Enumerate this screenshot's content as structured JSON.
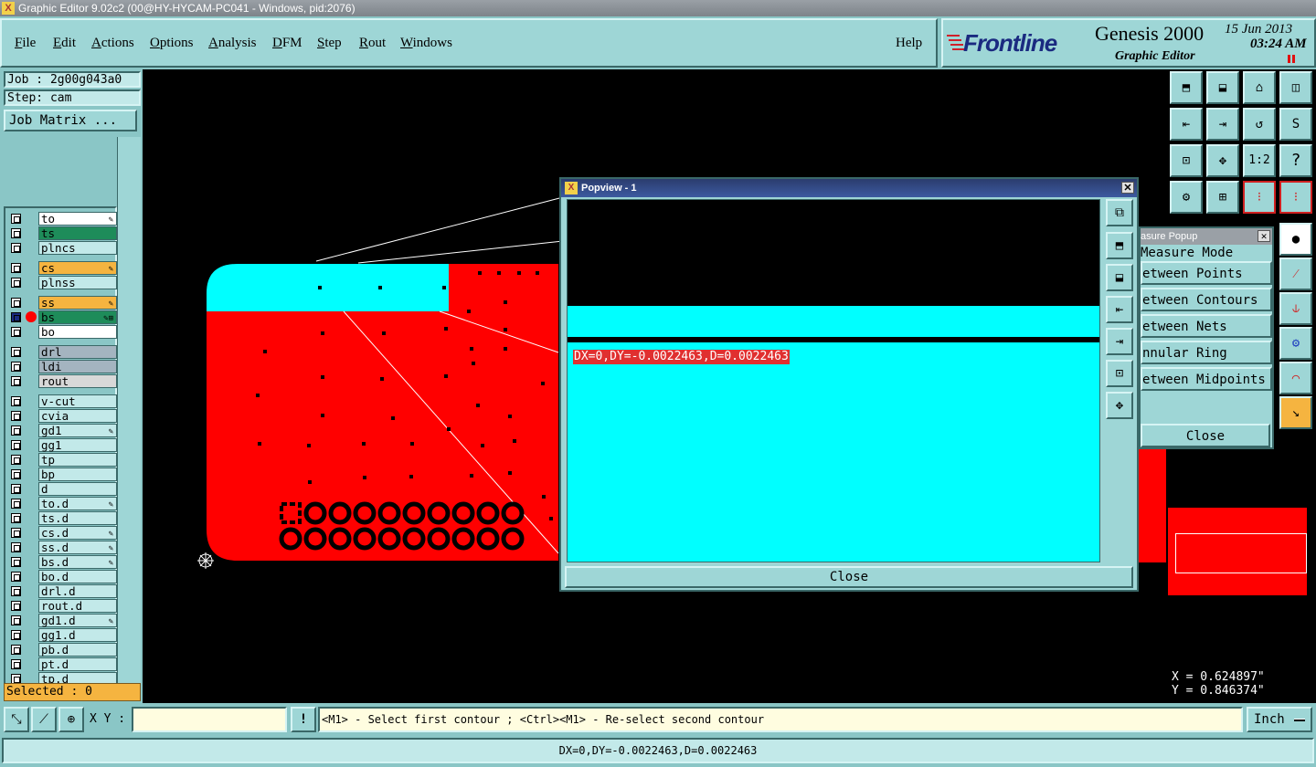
{
  "window": {
    "title": "Graphic Editor 9.02c2 (00@HY-HYCAM-PC041 - Windows, pid:2076)"
  },
  "menu": {
    "items": [
      {
        "label": "File",
        "underline": "F",
        "rest": "ile"
      },
      {
        "label": "Edit",
        "underline": "E",
        "rest": "dit"
      },
      {
        "label": "Actions",
        "underline": "A",
        "rest": "ctions"
      },
      {
        "label": "Options",
        "underline": "O",
        "rest": "ptions"
      },
      {
        "label": "Analysis",
        "underline": "A",
        "rest": "nalysis"
      },
      {
        "label": "DFM",
        "underline": "D",
        "rest": "FM"
      },
      {
        "label": "Step",
        "underline": "S",
        "rest": "tep"
      },
      {
        "label": "Rout",
        "underline": "R",
        "rest": "out"
      },
      {
        "label": "Windows",
        "underline": "W",
        "rest": "indows"
      }
    ],
    "help": "Help"
  },
  "brand": {
    "logo": "Frontline",
    "product": "Genesis 2000",
    "subtitle": "Graphic Editor",
    "date": "15 Jun 2013",
    "time": "03:24 AM"
  },
  "left": {
    "job": "Job : 2g00g043a0",
    "step": "Step: cam",
    "job_matrix": "Job Matrix ...",
    "selected": "Selected : 0"
  },
  "layers": [
    {
      "name": "to",
      "color": "#ffffff",
      "icon": "✎"
    },
    {
      "name": "ts",
      "color": "#1e8c5a",
      "icon": ""
    },
    {
      "name": "plncs",
      "color": "#c2e9e9",
      "icon": ""
    },
    {
      "name": "cs",
      "color": "#f5b440",
      "icon": "✎"
    },
    {
      "name": "plnss",
      "color": "#c2e9e9",
      "icon": ""
    },
    {
      "name": "ss",
      "color": "#f5b440",
      "icon": "✎"
    },
    {
      "name": "bs",
      "color": "#1e8c5a",
      "icon": "✎⊞"
    },
    {
      "name": "bo",
      "color": "#ffffff",
      "icon": ""
    },
    {
      "name": "drl",
      "color": "#a4b4c0",
      "icon": ""
    },
    {
      "name": "ldi",
      "color": "#a4b4c0",
      "icon": ""
    },
    {
      "name": "rout",
      "color": "#d8d8d8",
      "icon": ""
    },
    {
      "name": "v-cut",
      "color": "#c2e9e9",
      "icon": ""
    },
    {
      "name": "cvia",
      "color": "#c2e9e9",
      "icon": ""
    },
    {
      "name": "gd1",
      "color": "#c2e9e9",
      "icon": "✎"
    },
    {
      "name": "gg1",
      "color": "#c2e9e9",
      "icon": ""
    },
    {
      "name": "tp",
      "color": "#c2e9e9",
      "icon": ""
    },
    {
      "name": "bp",
      "color": "#c2e9e9",
      "icon": ""
    },
    {
      "name": "d",
      "color": "#c2e9e9",
      "icon": ""
    },
    {
      "name": "to.d",
      "color": "#c2e9e9",
      "icon": "✎"
    },
    {
      "name": "ts.d",
      "color": "#c2e9e9",
      "icon": ""
    },
    {
      "name": "cs.d",
      "color": "#c2e9e9",
      "icon": "✎"
    },
    {
      "name": "ss.d",
      "color": "#c2e9e9",
      "icon": "✎"
    },
    {
      "name": "bs.d",
      "color": "#c2e9e9",
      "icon": "✎"
    },
    {
      "name": "bo.d",
      "color": "#c2e9e9",
      "icon": ""
    },
    {
      "name": "drl.d",
      "color": "#c2e9e9",
      "icon": ""
    },
    {
      "name": "rout.d",
      "color": "#c2e9e9",
      "icon": ""
    },
    {
      "name": "gd1.d",
      "color": "#c2e9e9",
      "icon": "✎"
    },
    {
      "name": "gg1.d",
      "color": "#c2e9e9",
      "icon": ""
    },
    {
      "name": "pb.d",
      "color": "#c2e9e9",
      "icon": ""
    },
    {
      "name": "pt.d",
      "color": "#c2e9e9",
      "icon": ""
    },
    {
      "name": "tp.d",
      "color": "#c2e9e9",
      "icon": ""
    }
  ],
  "popview": {
    "title": "Popview - 1",
    "measurement": "DX=0,DY=-0.0022463,D=0.0022463",
    "close": "Close"
  },
  "measure_popup": {
    "title": "asure Popup",
    "mode_label": "Measure Mode",
    "options": [
      "etween Points",
      "etween Contours",
      "etween Nets",
      "nnular Ring",
      "etween Midpoints"
    ],
    "close": "Close"
  },
  "toolbox": {
    "ratio_label": "1:2",
    "help_label": "?"
  },
  "coords": {
    "x": "X = 0.624897\"",
    "y": "Y = 0.846374\""
  },
  "command": {
    "xy_label": "X Y :",
    "xy_value": "",
    "prompt": "<M1> - Select first contour ; <Ctrl><M1> - Re-select second contour",
    "units": "Inch"
  },
  "status": {
    "message": "DX=0,DY=-0.0022463,D=0.0022463"
  },
  "colors": {
    "copper": "#ff0000",
    "mask": "#00ffff",
    "panel": "#9ed6d6"
  }
}
